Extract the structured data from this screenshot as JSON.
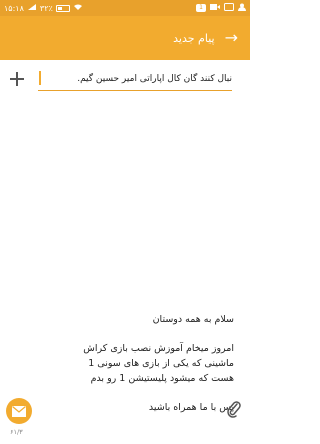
{
  "status_bar": {
    "time": "۱۵:۱۸",
    "battery": "۳۲٪",
    "signal_icon": "signal-icon",
    "wifi_icon": "wifi-icon"
  },
  "header": {
    "title": "پیام جدید",
    "back_icon": "arrow-right-icon"
  },
  "recipient": {
    "value": "نبال کنند گان کال اپاراتی امیر حسین گیم."
  },
  "message": {
    "lines": [
      "سلام به همه دوستان",
      "",
      "امروز میخام آموزش نصب بازی کراش",
      "ماشینی که یکی از بازی های سونی 1",
      "هست که میشود پلیستیشن 1 رو بدم",
      "",
      "پس با ما همراه باشید"
    ]
  },
  "compose": {
    "counter": "۶۱/۳"
  },
  "colors": {
    "accent": "#f2ab2f",
    "status": "#e8a12c"
  }
}
